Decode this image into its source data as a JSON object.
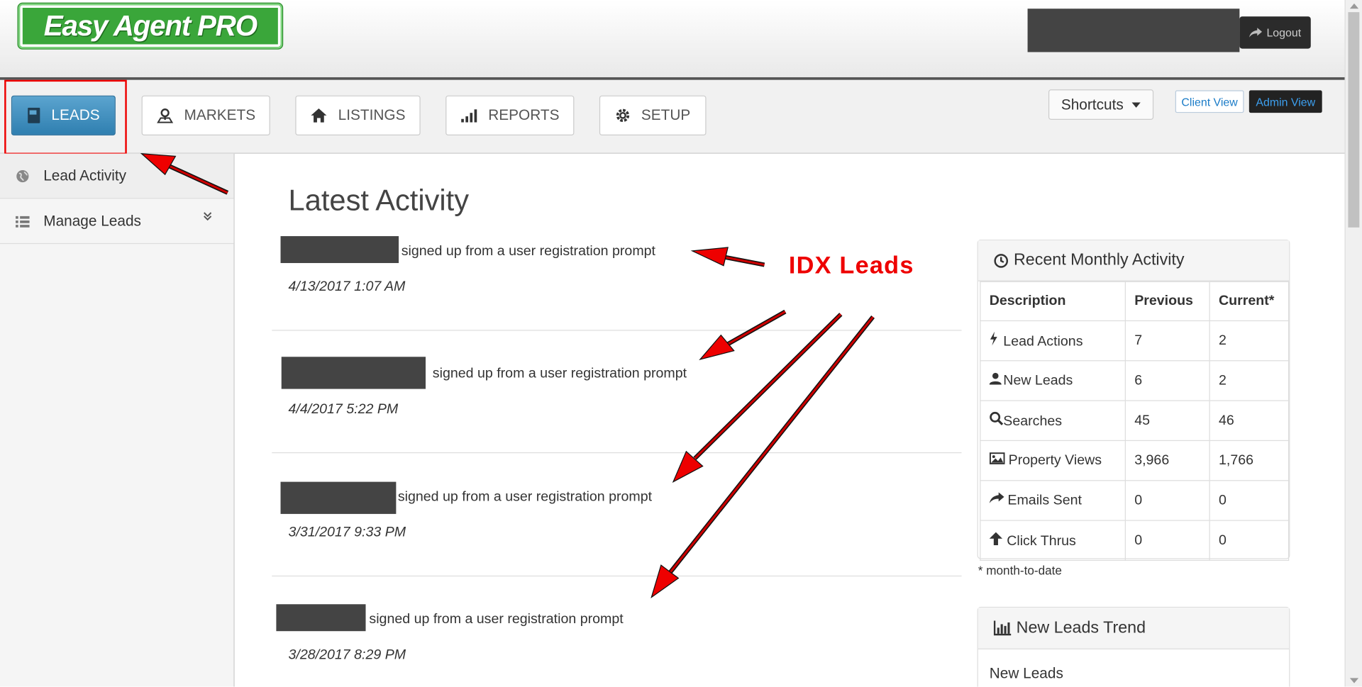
{
  "header": {
    "logo_text": "Easy Agent PRO",
    "logout_label": "Logout"
  },
  "nav": {
    "items": [
      {
        "label": "LEADS",
        "icon": "address-book-icon",
        "active": true
      },
      {
        "label": "MARKETS",
        "icon": "map-marker-icon",
        "active": false
      },
      {
        "label": "LISTINGS",
        "icon": "home-icon",
        "active": false
      },
      {
        "label": "REPORTS",
        "icon": "signal-bars-icon",
        "active": false
      },
      {
        "label": "SETUP",
        "icon": "gear-icon",
        "active": false
      }
    ],
    "shortcuts_label": "Shortcuts",
    "client_view_label": "Client View",
    "admin_view_label": "Admin View"
  },
  "sidebar": {
    "items": [
      {
        "label": "Lead Activity",
        "icon": "globe-icon"
      },
      {
        "label": "Manage Leads",
        "icon": "list-icon"
      }
    ]
  },
  "main": {
    "title": "Latest Activity",
    "activities": [
      {
        "text": "signed up from a user registration prompt",
        "timestamp": "4/13/2017 1:07 AM"
      },
      {
        "text": "signed up from a user registration prompt",
        "timestamp": "4/4/2017 5:22 PM"
      },
      {
        "text": "signed up from a user registration prompt",
        "timestamp": "3/31/2017 9:33 PM"
      },
      {
        "text": "signed up from a user registration prompt",
        "timestamp": "3/28/2017 8:29 PM"
      }
    ],
    "annotation_label": "IDX Leads"
  },
  "monthly": {
    "title": "Recent Monthly Activity",
    "columns": [
      "Description",
      "Previous",
      "Current*"
    ],
    "rows": [
      {
        "label": "Lead Actions",
        "icon": "bolt-icon",
        "previous": "7",
        "current": "2"
      },
      {
        "label": "New Leads",
        "icon": "user-icon",
        "previous": "6",
        "current": "2"
      },
      {
        "label": "Searches",
        "icon": "search-icon",
        "previous": "45",
        "current": "46"
      },
      {
        "label": "Property Views",
        "icon": "picture-icon",
        "previous": "3,966",
        "current": "1,766"
      },
      {
        "label": "Emails Sent",
        "icon": "share-icon",
        "previous": "0",
        "current": "0"
      },
      {
        "label": "Click Thrus",
        "icon": "arrow-up-icon",
        "previous": "0",
        "current": "0"
      }
    ],
    "footnote": "* month-to-date"
  },
  "trend": {
    "title": "New Leads Trend",
    "body": "New Leads"
  },
  "colors": {
    "accent": "#2f7fb0",
    "annotation": "#ee0000",
    "logo_green": "#3aa63a"
  }
}
